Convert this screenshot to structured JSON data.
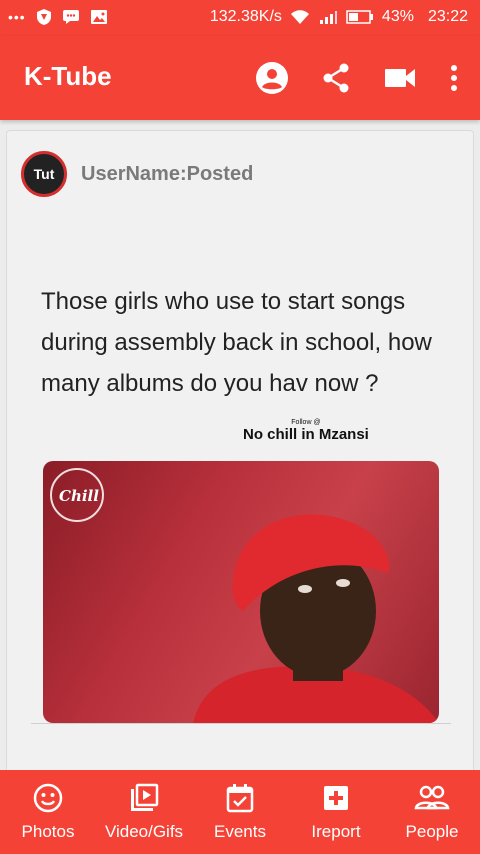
{
  "status_bar": {
    "network_speed": "132.38K/s",
    "battery": "43%",
    "time": "23:22"
  },
  "app_bar": {
    "title": "K-Tube",
    "actions": [
      "account-icon",
      "share-icon",
      "video-camera-icon",
      "more-vert-icon"
    ]
  },
  "post": {
    "username": "UserName:Posted",
    "avatar_text": "Tut",
    "meme_text": "Those girls who use to start songs during assembly back in school, how many albums do you hav now ?",
    "follow_small": "Follow @",
    "follow_big": "No chill in Mzansi",
    "watermark_text": "Chill"
  },
  "bottom_nav": [
    {
      "label": "Photos",
      "icon": "smiley-icon"
    },
    {
      "label": "Video/Gifs",
      "icon": "video-library-icon"
    },
    {
      "label": "Events",
      "icon": "calendar-icon"
    },
    {
      "label": "Ireport",
      "icon": "add-box-icon"
    },
    {
      "label": "People",
      "icon": "people-icon"
    }
  ],
  "colors": {
    "primary": "#f44336",
    "card_bg": "#f1f1f1",
    "username": "#7a7a7a"
  }
}
